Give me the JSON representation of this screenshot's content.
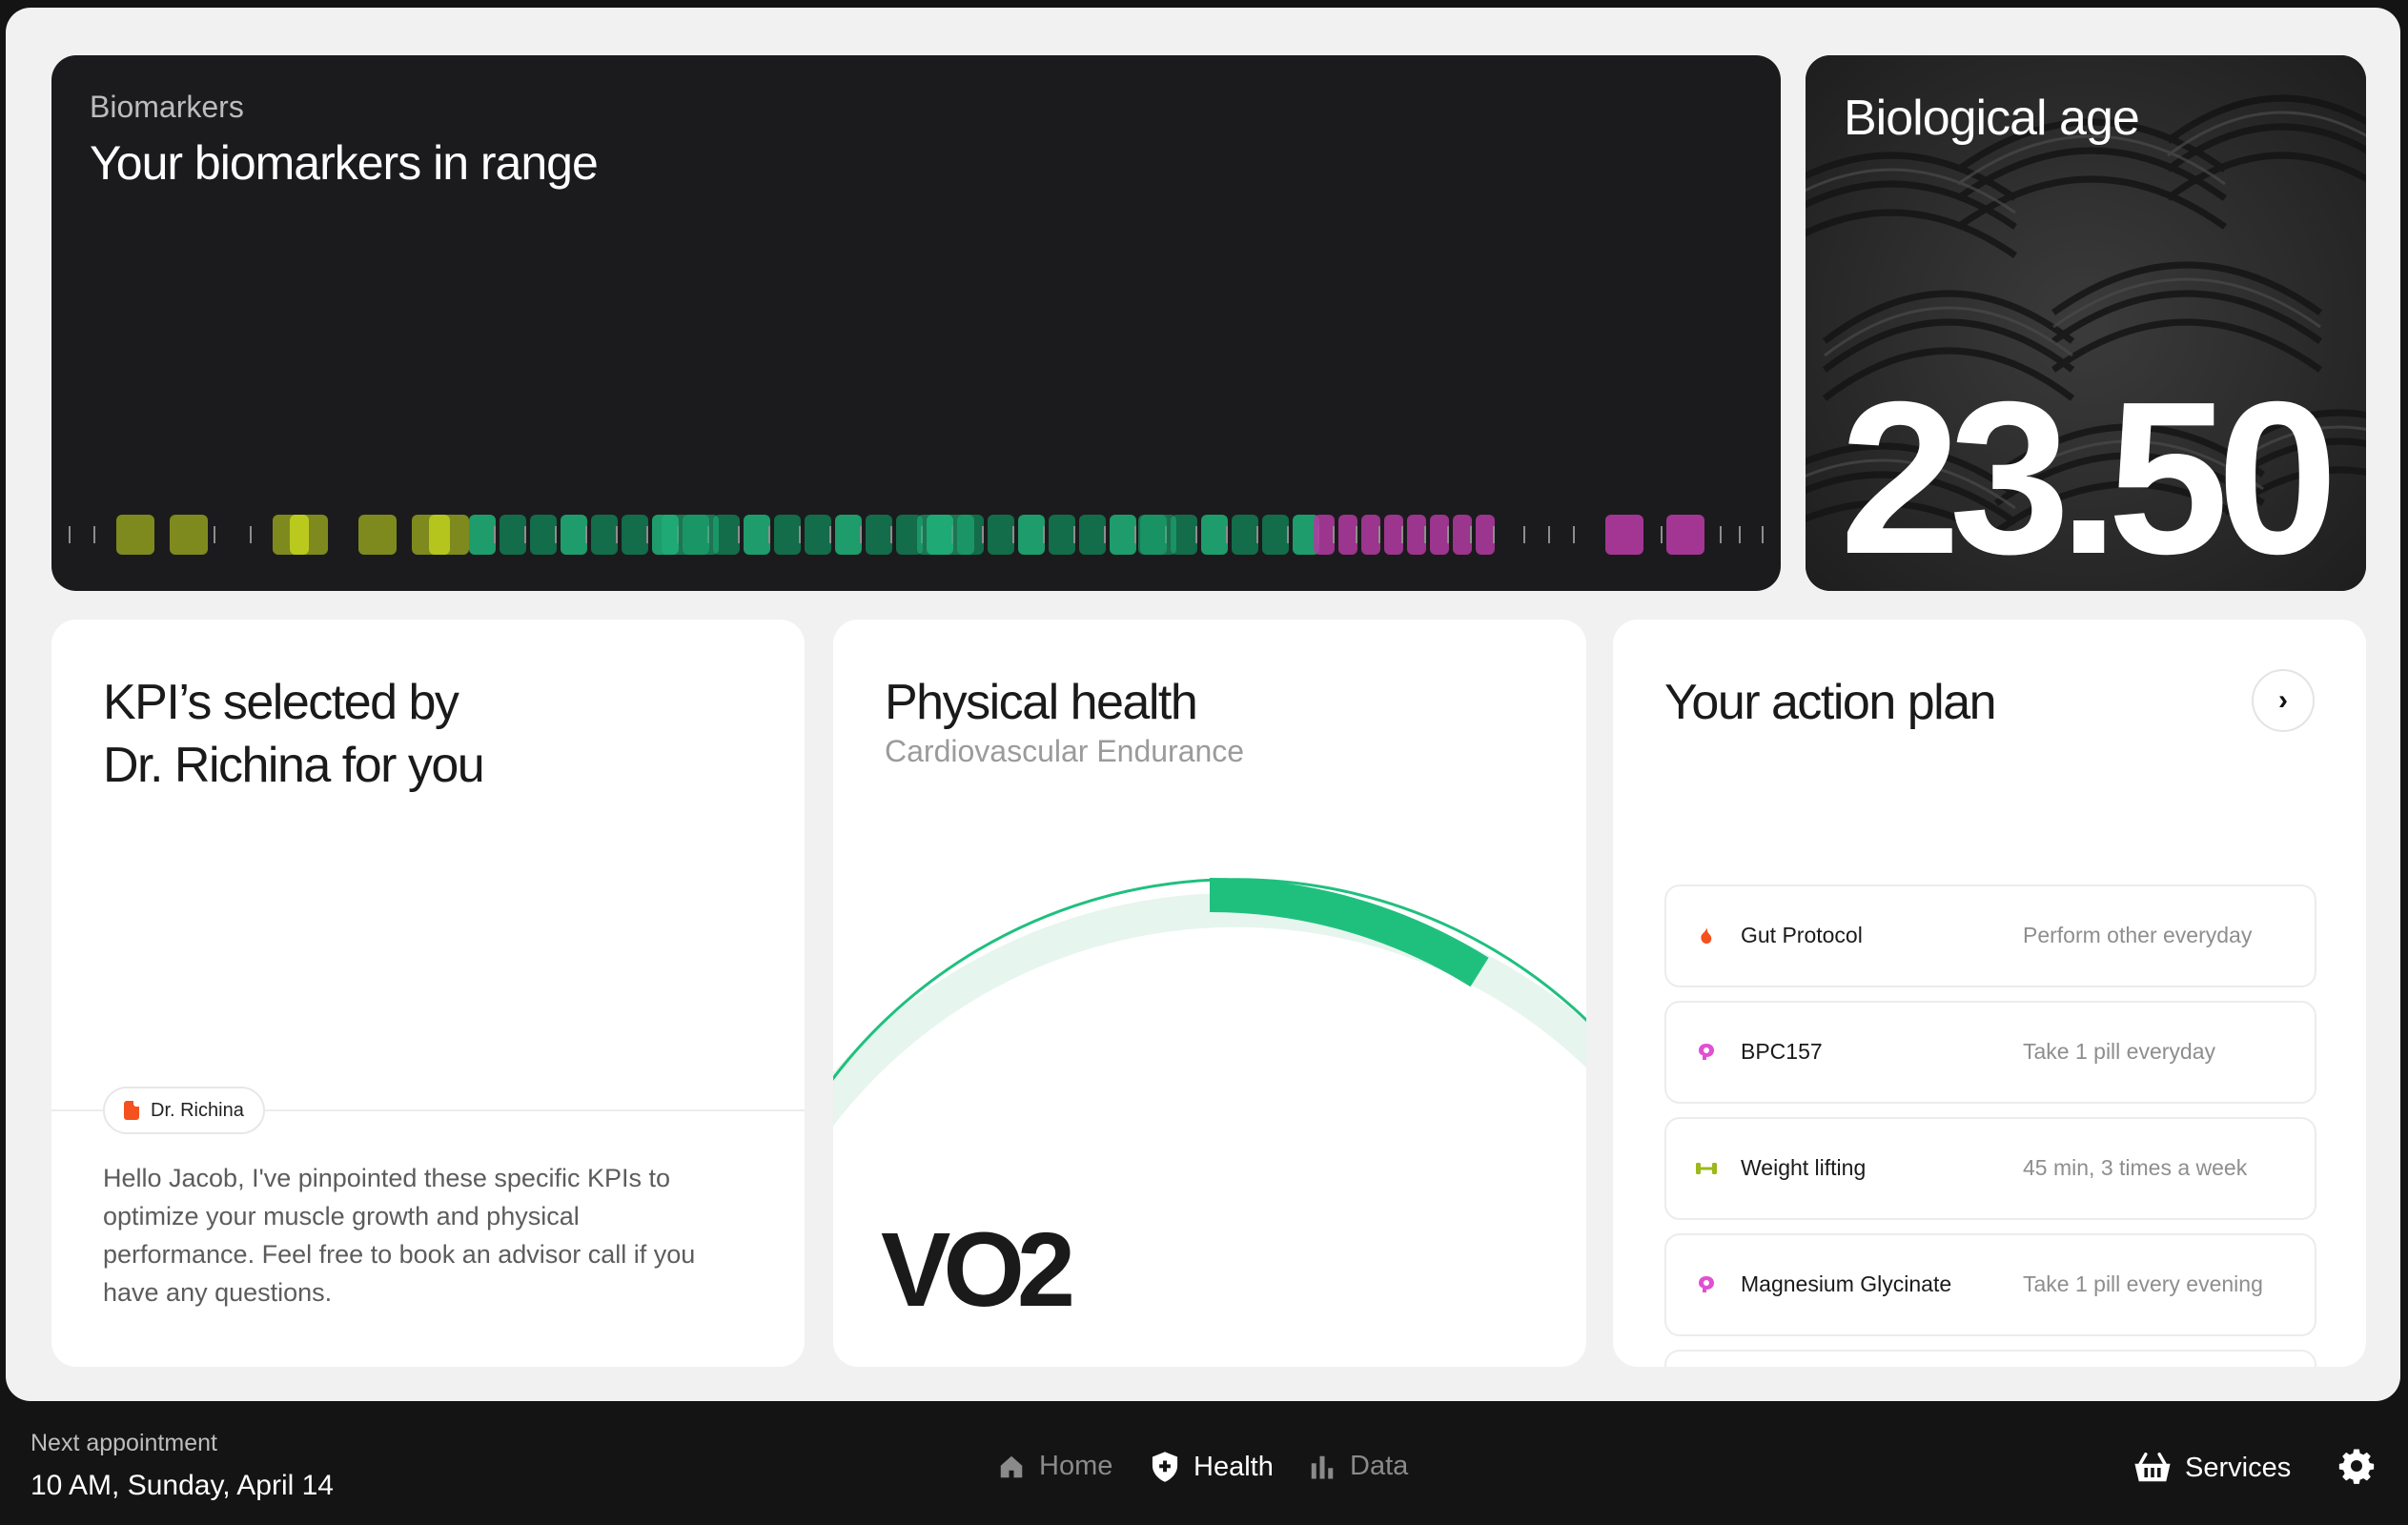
{
  "biomarkers": {
    "eyebrow": "Biomarkers",
    "title": "Your biomarkers in range",
    "colors": {
      "olive": "#7e8a1d",
      "yellow": "#c9d81f",
      "green": "#1fb37a",
      "green_dark": "#127a52",
      "magenta": "#b23aa1",
      "pink": "#e25ad0",
      "tick": "#8d8d8d"
    }
  },
  "biological_age": {
    "label": "Biological age",
    "value": "23.50"
  },
  "kpi": {
    "title_line1": "KPI’s selected by",
    "title_line2": "Dr. Richina for you",
    "chip": "Dr. Richina",
    "message": "Hello Jacob, I've pinpointed these specific KPIs to optimize your muscle growth and physical performance. Feel free to book an advisor call if you have any questions."
  },
  "physical": {
    "title": "Physical health",
    "subtitle": "Cardiovascular Endurance",
    "metric": "VO2",
    "accent": "#1fc07e",
    "track": "#e7f6ef"
  },
  "plan": {
    "title": "Your action plan",
    "arrow": "›",
    "items": [
      {
        "name": "Gut Protocol",
        "note": "Perform other everyday",
        "icon": "stomach-icon",
        "color": "#f4511e"
      },
      {
        "name": "BPC157",
        "note": "Take 1 pill everyday",
        "icon": "brain-icon",
        "color": "#e24fd1"
      },
      {
        "name": "Weight lifting",
        "note": "45 min, 3 times a week",
        "icon": "dumbbell-icon",
        "color": "#9bb81c"
      },
      {
        "name": "Magnesium Glycinate",
        "note": "Take 1 pill every evening",
        "icon": "brain-icon",
        "color": "#e24fd1"
      }
    ]
  },
  "footer": {
    "appointment_label": "Next appointment",
    "appointment_value": "10 AM, Sunday, April 14",
    "nav": {
      "home": "Home",
      "health": "Health",
      "data": "Data"
    },
    "services": "Services"
  }
}
